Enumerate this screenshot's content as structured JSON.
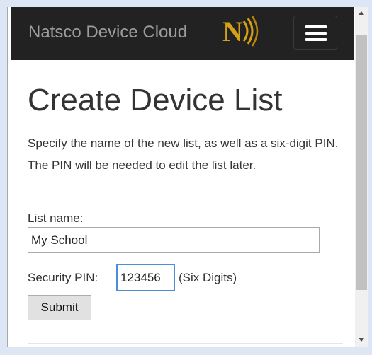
{
  "navbar": {
    "brand": "Natsco Device Cloud",
    "logo_icon": "natsco-n-logo-icon",
    "menu_icon": "hamburger-menu-icon",
    "background": "#222222",
    "logo_color": "#d4a017"
  },
  "page": {
    "title": "Create Device List",
    "description": "Specify the name of the new list, as well as a six-digit PIN. The PIN will be needed to edit the list later."
  },
  "form": {
    "list_name_label": "List name:",
    "list_name_value": "My School",
    "pin_label": "Security PIN:",
    "pin_value": "123456",
    "pin_hint": "(Six Digits)",
    "submit_label": "Submit"
  },
  "scrollbar": {
    "up_icon": "scroll-up-arrow-icon",
    "down_icon": "scroll-down-arrow-icon"
  }
}
